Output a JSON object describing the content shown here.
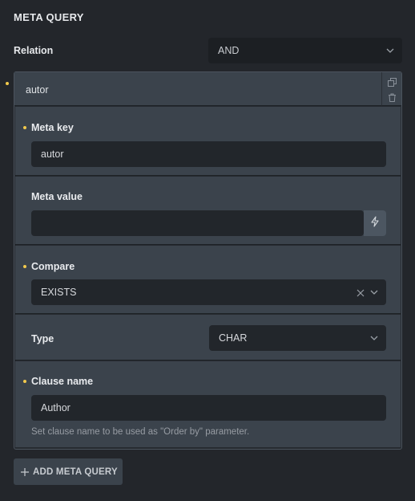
{
  "section": {
    "title": "META QUERY"
  },
  "relation": {
    "label": "Relation",
    "value": "AND"
  },
  "group": {
    "title": "autor",
    "icons": {
      "duplicate": "copy-icon",
      "remove": "trash-icon"
    }
  },
  "fields": {
    "meta_key": {
      "label": "Meta key",
      "value": "autor",
      "required": true
    },
    "meta_value": {
      "label": "Meta value",
      "value": "",
      "dynamic_icon": "bolt-icon"
    },
    "compare": {
      "label": "Compare",
      "value": "EXISTS",
      "required": true
    },
    "type": {
      "label": "Type",
      "value": "CHAR"
    },
    "clause_name": {
      "label": "Clause name",
      "value": "Author",
      "required": true,
      "help": "Set clause name to be used as \"Order by\" parameter."
    }
  },
  "add_button": {
    "label": "ADD META QUERY",
    "icon": "plus-icon"
  },
  "colors": {
    "accent_required": "#f2c94c",
    "panel": "#3b434c",
    "input": "#22262b"
  }
}
